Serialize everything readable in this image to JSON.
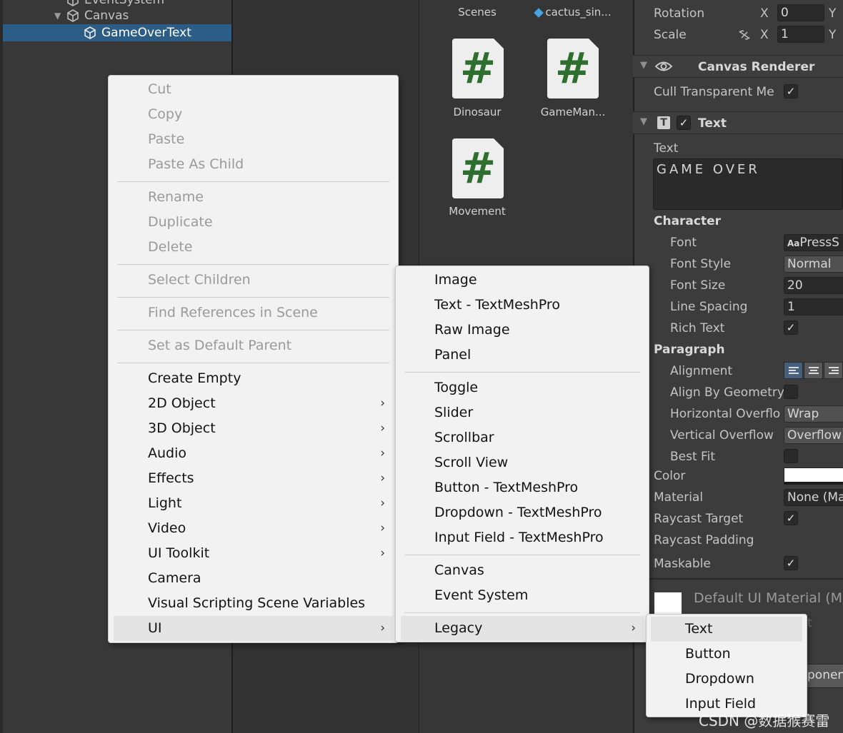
{
  "hierarchy": {
    "items": [
      {
        "label": "EventSystem"
      },
      {
        "label": "Canvas"
      },
      {
        "label": "GameOverText"
      }
    ]
  },
  "project": {
    "assets": [
      {
        "label": "Scenes"
      },
      {
        "label": "cactus_sin..."
      },
      {
        "label": "Dinosaur",
        "icon": "csharp-script-icon",
        "glyph": "#"
      },
      {
        "label": "GameMan...",
        "icon": "csharp-script-icon",
        "glyph": "#"
      },
      {
        "label": "Movement",
        "icon": "csharp-script-icon",
        "glyph": "#"
      }
    ]
  },
  "inspector": {
    "transform": {
      "rotation_label": "Rotation",
      "scale_label": "Scale",
      "x_label": "X",
      "y_label": "Y",
      "rotation_x": "0",
      "scale_x": "1"
    },
    "canvas_renderer": {
      "title": "Canvas Renderer",
      "cull_label": "Cull Transparent Me",
      "cull_checked": true
    },
    "text_component": {
      "title": "Text",
      "text_label": "Text",
      "text_value": "GAME OVER",
      "character_label": "Character",
      "font_label": "Font",
      "font_value": "PressS",
      "font_prefix": "Aa",
      "font_style_label": "Font Style",
      "font_style_value": "Normal",
      "font_size_label": "Font Size",
      "font_size_value": "20",
      "line_spacing_label": "Line Spacing",
      "line_spacing_value": "1",
      "rich_text_label": "Rich Text",
      "paragraph_label": "Paragraph",
      "alignment_label": "Alignment",
      "align_geometry_label": "Align By Geometry",
      "h_overflow_label": "Horizontal Overflo",
      "h_overflow_value": "Wrap",
      "v_overflow_label": "Vertical Overflow",
      "v_overflow_value": "Overflow",
      "best_fit_label": "Best Fit",
      "color_label": "Color",
      "material_label": "Material",
      "material_value": "None (Ma",
      "raycast_target_label": "Raycast Target",
      "raycast_padding_label": "Raycast Padding",
      "maskable_label": "Maskable",
      "default_material_label": "Default UI Material (M",
      "partial_t": "t",
      "partial_component": "ponen"
    }
  },
  "context_menu": {
    "items": [
      {
        "label": "Cut",
        "disabled": true
      },
      {
        "label": "Copy",
        "disabled": true
      },
      {
        "label": "Paste",
        "disabled": true
      },
      {
        "label": "Paste As Child",
        "disabled": true
      },
      {
        "label": "Rename",
        "disabled": true
      },
      {
        "label": "Duplicate",
        "disabled": true
      },
      {
        "label": "Delete",
        "disabled": true
      },
      {
        "label": "Select Children",
        "disabled": true
      },
      {
        "label": "Find References in Scene",
        "disabled": true
      },
      {
        "label": "Set as Default Parent",
        "disabled": true
      },
      {
        "label": "Create Empty",
        "disabled": false
      },
      {
        "label": "2D Object",
        "submenu": true
      },
      {
        "label": "3D Object",
        "submenu": true
      },
      {
        "label": "Audio",
        "submenu": true
      },
      {
        "label": "Effects",
        "submenu": true
      },
      {
        "label": "Light",
        "submenu": true
      },
      {
        "label": "Video",
        "submenu": true
      },
      {
        "label": "UI Toolkit",
        "submenu": true
      },
      {
        "label": "Camera",
        "disabled": false
      },
      {
        "label": "Visual Scripting Scene Variables",
        "disabled": false
      },
      {
        "label": "UI",
        "submenu": true,
        "highlighted": true
      }
    ],
    "arrow": "›"
  },
  "ui_submenu": {
    "items": [
      {
        "label": "Image"
      },
      {
        "label": "Text - TextMeshPro"
      },
      {
        "label": "Raw Image"
      },
      {
        "label": "Panel"
      },
      {
        "label": "Toggle"
      },
      {
        "label": "Slider"
      },
      {
        "label": "Scrollbar"
      },
      {
        "label": "Scroll View"
      },
      {
        "label": "Button - TextMeshPro"
      },
      {
        "label": "Dropdown - TextMeshPro"
      },
      {
        "label": "Input Field - TextMeshPro"
      },
      {
        "label": "Canvas"
      },
      {
        "label": "Event System"
      },
      {
        "label": "Legacy",
        "submenu": true,
        "highlighted": true
      }
    ]
  },
  "legacy_submenu": {
    "items": [
      {
        "label": "Text",
        "highlighted": true
      },
      {
        "label": "Button"
      },
      {
        "label": "Dropdown"
      },
      {
        "label": "Input Field"
      }
    ]
  },
  "watermark": "CSDN @数据猴赛雷",
  "colors": {
    "selection": "#2c5d87",
    "menu_bg": "#f2f2f2",
    "script_glyph": "#2e6e2e"
  }
}
